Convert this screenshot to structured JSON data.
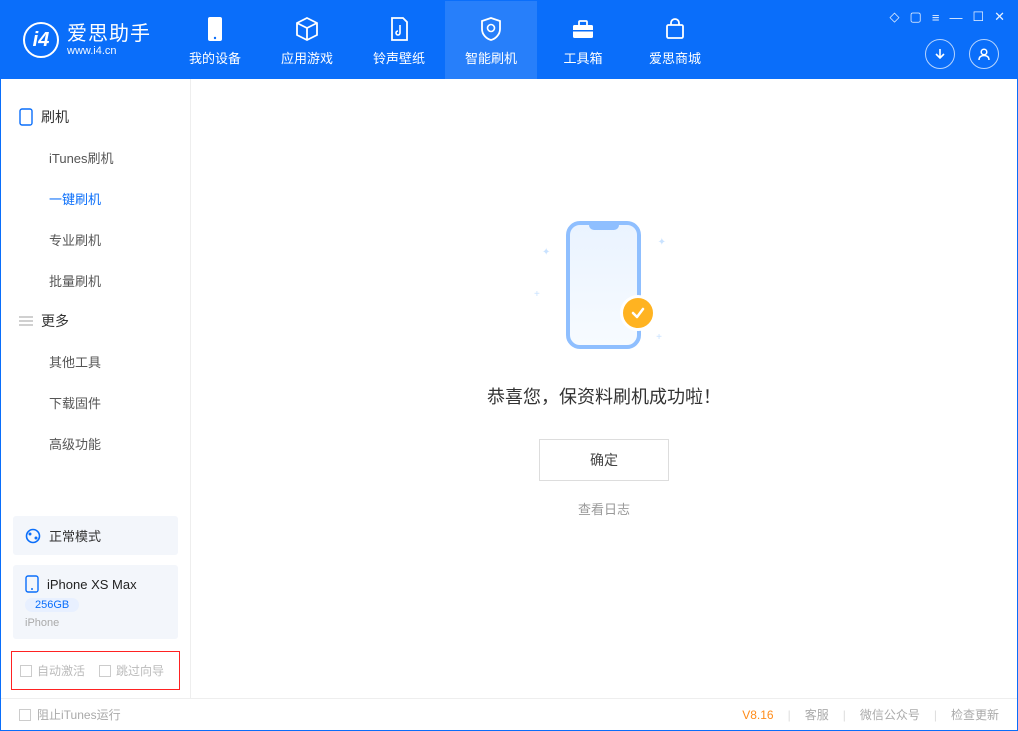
{
  "app": {
    "name": "爱思助手",
    "url": "www.i4.cn"
  },
  "nav": {
    "tabs": [
      {
        "label": "我的设备"
      },
      {
        "label": "应用游戏"
      },
      {
        "label": "铃声壁纸"
      },
      {
        "label": "智能刷机"
      },
      {
        "label": "工具箱"
      },
      {
        "label": "爱思商城"
      }
    ],
    "active_index": 3
  },
  "sidebar": {
    "section1": {
      "title": "刷机"
    },
    "items1": [
      {
        "label": "iTunes刷机"
      },
      {
        "label": "一键刷机"
      },
      {
        "label": "专业刷机"
      },
      {
        "label": "批量刷机"
      }
    ],
    "active_item1": 1,
    "section2": {
      "title": "更多"
    },
    "items2": [
      {
        "label": "其他工具"
      },
      {
        "label": "下载固件"
      },
      {
        "label": "高级功能"
      }
    ]
  },
  "device": {
    "mode": "正常模式",
    "name": "iPhone XS Max",
    "capacity": "256GB",
    "type": "iPhone"
  },
  "options": {
    "auto_activate": "自动激活",
    "skip_wizard": "跳过向导"
  },
  "main": {
    "success_title": "恭喜您，保资料刷机成功啦！",
    "ok_button": "确定",
    "view_log": "查看日志"
  },
  "footer": {
    "block_itunes": "阻止iTunes运行",
    "version": "V8.16",
    "customer_service": "客服",
    "wechat": "微信公众号",
    "check_update": "检查更新"
  }
}
